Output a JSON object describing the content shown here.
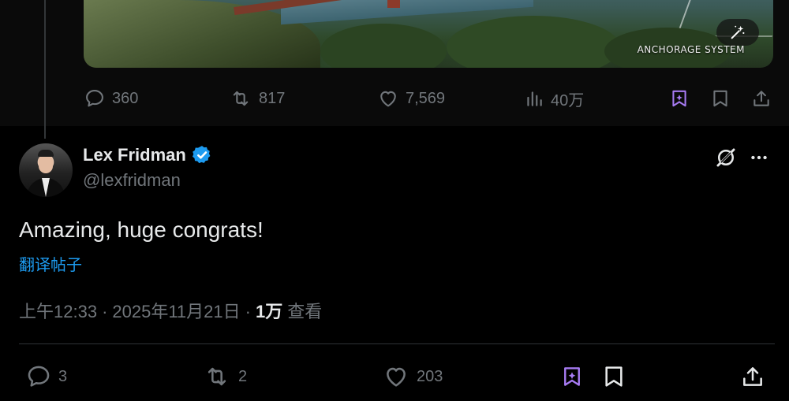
{
  "prev_tweet": {
    "media": {
      "watermark": "ANCHORAGE SYSTEM",
      "edit_icon": "magic-wand-icon"
    },
    "actions": {
      "reply_count": "360",
      "retweet_count": "817",
      "like_count": "7,569",
      "views_count": "40万"
    }
  },
  "tweet": {
    "author": {
      "display_name": "Lex Fridman",
      "handle": "@lexfridman",
      "verified": true
    },
    "text": "Amazing, huge congrats!",
    "translate_label": "翻译帖子",
    "time": "上午12:33",
    "separator": "·",
    "date": "2025年11月21日",
    "views_number": "1万",
    "views_label": "查看",
    "actions": {
      "reply_count": "3",
      "retweet_count": "2",
      "like_count": "203"
    }
  },
  "colors": {
    "background": "#000000",
    "text_primary": "#e7e9ea",
    "text_secondary": "#71767b",
    "link": "#1d9bf0",
    "verified": "#1d9bf0",
    "grok_purple": "#a77bf3",
    "divider": "#2f3336"
  }
}
